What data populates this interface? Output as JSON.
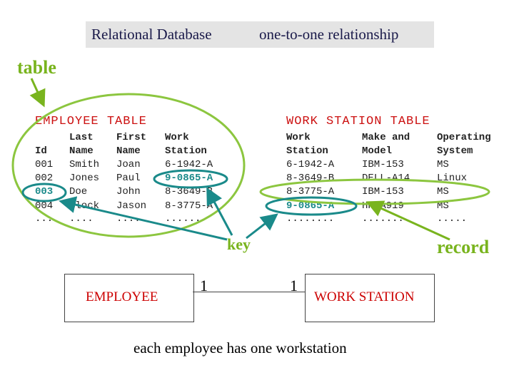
{
  "header": {
    "left": "Relational Database",
    "right": "one-to-one relationship"
  },
  "labels": {
    "table": "table",
    "key": "key",
    "record": "record"
  },
  "employee_table": {
    "title": "EMPLOYEE TABLE",
    "headers": [
      [
        "",
        "Id"
      ],
      [
        "Last",
        "Name"
      ],
      [
        "First",
        "Name"
      ],
      [
        "Work",
        "Station"
      ]
    ],
    "rows": [
      [
        "001",
        "Smith",
        "Joan",
        "6-1942-A"
      ],
      [
        "002",
        "Jones",
        "Paul",
        "9-0865-A"
      ],
      [
        "003",
        "Doe",
        "John",
        "8-3649-B"
      ],
      [
        "004",
        "Block",
        "Jason",
        "8-3775-A"
      ],
      [
        "...",
        "....",
        "....",
        "......"
      ]
    ]
  },
  "workstation_table": {
    "title": "WORK STATION TABLE",
    "headers": [
      [
        "Work",
        "Station"
      ],
      [
        "Make and",
        "Model"
      ],
      [
        "Operating",
        "System"
      ]
    ],
    "rows": [
      [
        "6-1942-A",
        "IBM-153",
        "MS"
      ],
      [
        "8-3649-B",
        "DELL-A14",
        "Linux"
      ],
      [
        "8-3775-A",
        "IBM-153",
        "MS"
      ],
      [
        "9-0865-A",
        "HP-A919",
        "MS"
      ],
      [
        "........",
        "........",
        "....."
      ]
    ]
  },
  "er": {
    "left_entity": "EMPLOYEE",
    "right_entity": "WORK STATION",
    "left_card": "1",
    "right_card": "1",
    "caption": "each employee has one workstation"
  },
  "colors": {
    "green": "#79b41e",
    "teal": "#1a8a8a",
    "red": "#cc1111"
  }
}
